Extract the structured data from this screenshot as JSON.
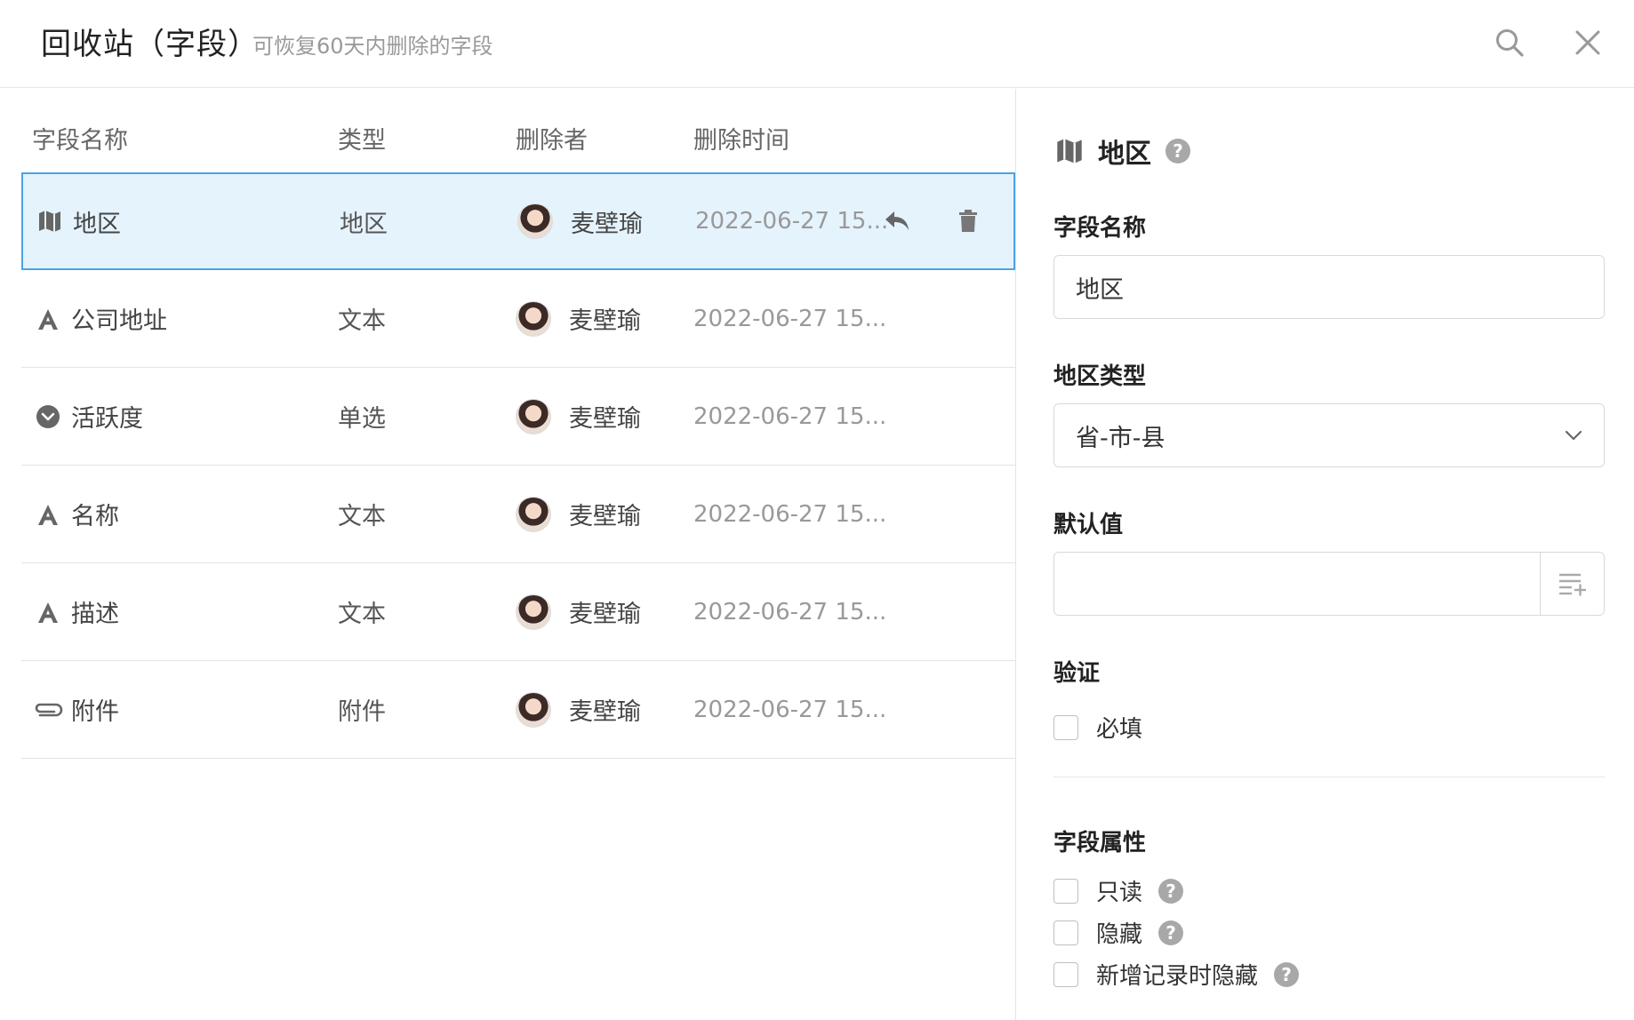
{
  "header": {
    "title": "回收站（字段）",
    "subtitle": "可恢复60天内删除的字段"
  },
  "columns": {
    "name": "字段名称",
    "type": "类型",
    "deleter": "删除者",
    "time": "删除时间"
  },
  "rows": [
    {
      "icon": "map-icon",
      "name": "地区",
      "type": "地区",
      "deleter": "麦壁瑜",
      "time": "2022-06-27 15...",
      "selected": true
    },
    {
      "icon": "text-icon",
      "name": "公司地址",
      "type": "文本",
      "deleter": "麦壁瑜",
      "time": "2022-06-27 15..."
    },
    {
      "icon": "single-select-icon",
      "name": "活跃度",
      "type": "单选",
      "deleter": "麦壁瑜",
      "time": "2022-06-27 15..."
    },
    {
      "icon": "text-icon",
      "name": "名称",
      "type": "文本",
      "deleter": "麦壁瑜",
      "time": "2022-06-27 15..."
    },
    {
      "icon": "text-icon",
      "name": "描述",
      "type": "文本",
      "deleter": "麦壁瑜",
      "time": "2022-06-27 15..."
    },
    {
      "icon": "attachment-icon",
      "name": "附件",
      "type": "附件",
      "deleter": "麦壁瑜",
      "time": "2022-06-27 15..."
    }
  ],
  "detail": {
    "icon": "map-icon",
    "title": "地区",
    "field_name_label": "字段名称",
    "field_name_value": "地区",
    "region_type_label": "地区类型",
    "region_type_value": "省-市-县",
    "default_label": "默认值",
    "default_value": "",
    "validation_label": "验证",
    "required_label": "必填",
    "required_checked": false,
    "props_label": "字段属性",
    "readonly_label": "只读",
    "readonly_checked": false,
    "hidden_label": "隐藏",
    "hidden_checked": false,
    "hide_on_new_label": "新增记录时隐藏",
    "hide_on_new_checked": false
  },
  "colors": {
    "selected_bg": "#e5f3fd",
    "selected_border": "#4aa3e8",
    "muted": "#999999"
  }
}
